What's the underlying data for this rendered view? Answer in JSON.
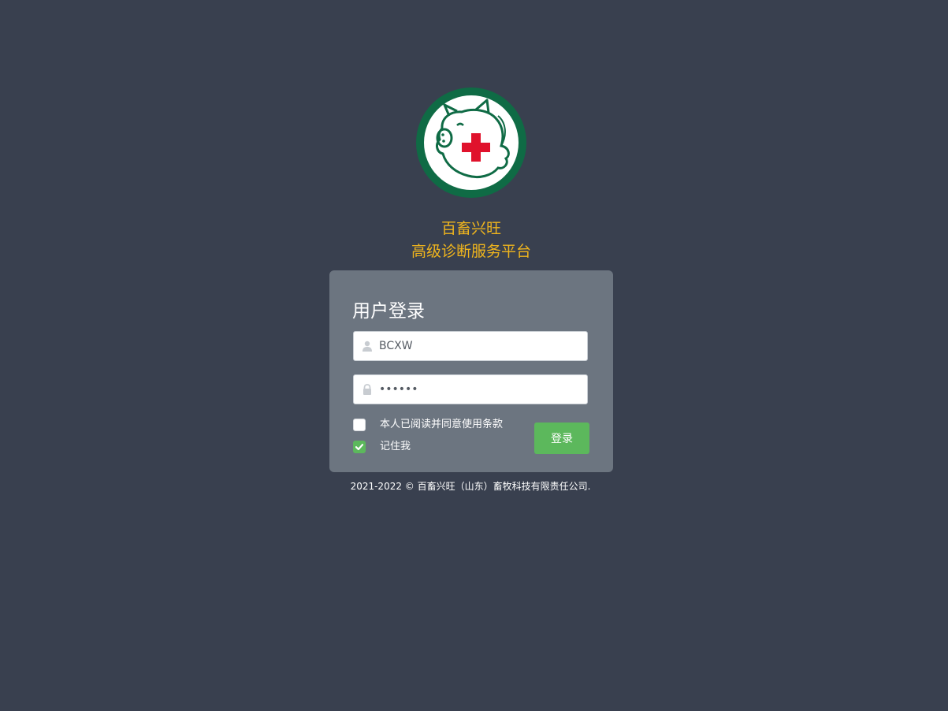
{
  "brand": {
    "line1": "百畜兴旺",
    "line2": "高级诊断服务平台"
  },
  "login": {
    "title": "用户登录",
    "username": {
      "value": "BCXW",
      "icon": "user-icon"
    },
    "password": {
      "value": "123456",
      "icon": "lock-icon"
    },
    "agree_label": "本人已阅读并同意使用条款",
    "agree_checked": false,
    "remember_label": "记住我",
    "remember_checked": true,
    "submit_label": "登录"
  },
  "footer": {
    "copyright": "2021-2022 © 百畜兴旺（山东）畜牧科技有限责任公司."
  },
  "colors": {
    "background": "#39404f",
    "panel": "#6c7580",
    "brand_text": "#f0b51d",
    "accent_green": "#5cb85c",
    "logo_green": "#0f6b45",
    "cross_red": "#e0122c"
  }
}
